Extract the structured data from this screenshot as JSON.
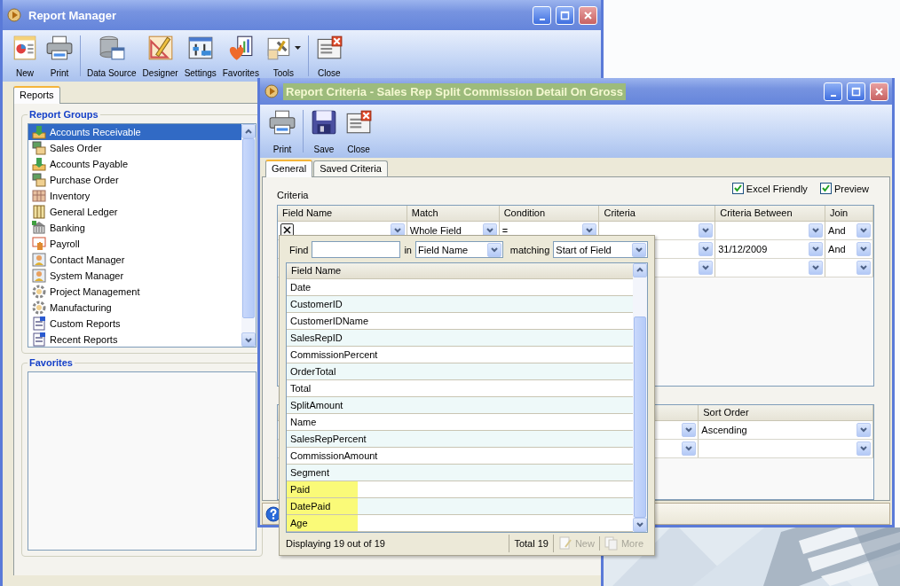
{
  "report_manager": {
    "title": "Report Manager",
    "toolbar": [
      {
        "label": "New",
        "kind": "button"
      },
      {
        "label": "Print",
        "kind": "button"
      },
      {
        "kind": "separator"
      },
      {
        "label": "Data Source",
        "kind": "button"
      },
      {
        "label": "Designer",
        "kind": "button"
      },
      {
        "label": "Settings",
        "kind": "button"
      },
      {
        "label": "Favorites",
        "kind": "button"
      },
      {
        "label": "Tools",
        "kind": "menu-button"
      },
      {
        "kind": "separator"
      },
      {
        "label": "Close",
        "kind": "button"
      }
    ],
    "tabs": [
      {
        "label": "Reports",
        "selected": true
      }
    ],
    "report_groups": {
      "title": "Report Groups",
      "items": [
        {
          "label": "Accounts Receivable",
          "selected": true
        },
        {
          "label": "Sales Order",
          "selected": false
        },
        {
          "label": "Accounts Payable",
          "selected": false
        },
        {
          "label": "Purchase Order",
          "selected": false
        },
        {
          "label": "Inventory",
          "selected": false
        },
        {
          "label": "General Ledger",
          "selected": false
        },
        {
          "label": "Banking",
          "selected": false
        },
        {
          "label": "Payroll",
          "selected": false
        },
        {
          "label": "Contact Manager",
          "selected": false
        },
        {
          "label": "System Manager",
          "selected": false
        },
        {
          "label": "Project Management",
          "selected": false
        },
        {
          "label": "Manufacturing",
          "selected": false
        },
        {
          "label": "Custom Reports",
          "selected": false
        },
        {
          "label": "Recent Reports",
          "selected": false
        }
      ]
    },
    "favorites": {
      "title": "Favorites"
    }
  },
  "report_criteria": {
    "title": "Report Criteria - Sales Rep Split Commission Detail On Gross",
    "title_highlighted": true,
    "toolbar": [
      {
        "label": "Print",
        "kind": "button"
      },
      {
        "kind": "separator"
      },
      {
        "label": "Save",
        "kind": "button"
      },
      {
        "label": "Close",
        "kind": "button"
      }
    ],
    "tabs": [
      {
        "label": "General",
        "selected": true
      },
      {
        "label": "Saved Criteria",
        "selected": false
      }
    ],
    "criteria_label": "Criteria",
    "options": [
      {
        "label": "Excel Friendly",
        "checked": true
      },
      {
        "label": "Preview",
        "checked": true
      }
    ],
    "criteria_grid": {
      "columns": [
        "Field Name",
        "Match",
        "Condition",
        "Criteria",
        "Criteria Between",
        "Join"
      ],
      "rows": [
        {
          "delete_button": true,
          "match": "Whole Field",
          "condition": "=",
          "join": "And"
        },
        {
          "criteria_between": "31/12/2009",
          "join": "And"
        },
        {}
      ]
    },
    "sort_grid": {
      "sort_order_heading": "Sort Order",
      "rows": [
        {
          "sort_order": "Ascending"
        },
        {
          "sort_order": null
        }
      ]
    },
    "field_picker": {
      "find_label": "Find",
      "in_label": "in",
      "in_value": "Field Name",
      "matching_label": "matching",
      "matching_value": "Start of Field",
      "column": "Field Name",
      "items": [
        {
          "label": "Date",
          "highlighted": false
        },
        {
          "label": "CustomerID",
          "highlighted": false
        },
        {
          "label": "CustomerIDName",
          "highlighted": false
        },
        {
          "label": "SalesRepID",
          "highlighted": false
        },
        {
          "label": "CommissionPercent",
          "highlighted": false
        },
        {
          "label": "OrderTotal",
          "highlighted": false
        },
        {
          "label": "Total",
          "highlighted": false
        },
        {
          "label": "SplitAmount",
          "highlighted": false
        },
        {
          "label": "Name",
          "highlighted": false
        },
        {
          "label": "SalesRepPercent",
          "highlighted": false
        },
        {
          "label": "CommissionAmount",
          "highlighted": false
        },
        {
          "label": "Segment",
          "highlighted": false
        },
        {
          "label": "Paid",
          "highlighted": true
        },
        {
          "label": "DatePaid",
          "highlighted": true
        },
        {
          "label": "Age",
          "highlighted": true
        }
      ],
      "status": "Displaying 19 out of 19",
      "total": "Total 19",
      "buttons": [
        {
          "label": "New",
          "disabled": true
        },
        {
          "label": "More",
          "disabled": true
        }
      ]
    }
  }
}
